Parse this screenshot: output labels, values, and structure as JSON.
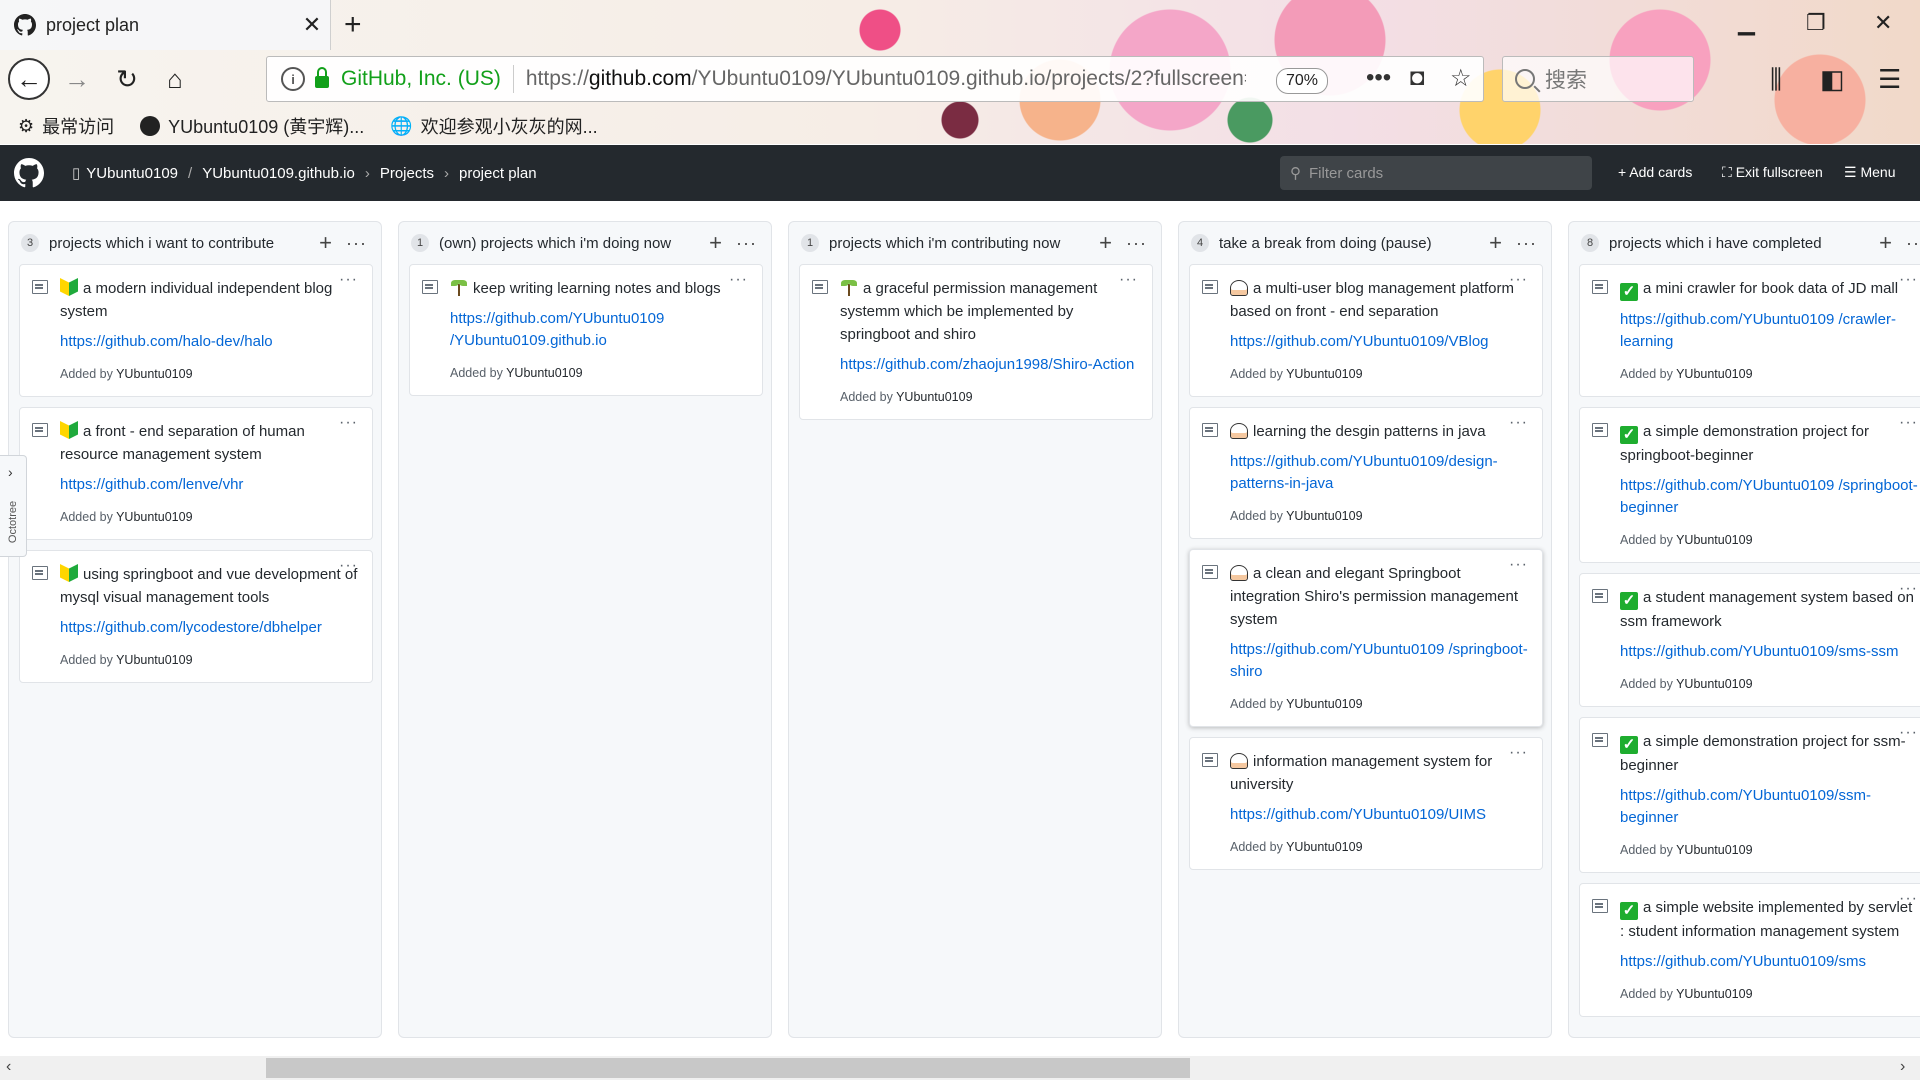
{
  "browser": {
    "tab_title": "project plan",
    "tab_close": "✕",
    "new_tab": "+",
    "url_org": "GitHub, Inc. (US)",
    "url_prefix": "https://",
    "url_domain": "github.com",
    "url_path": "/YUbuntu0109/YUbuntu0109.github.io/projects/2?fullscreen=true",
    "zoom": "70%",
    "search_placeholder": "搜索",
    "bookmarks": [
      "最常访问",
      "YUbuntu0109 (黄宇辉)...",
      "欢迎参观小灰灰的网..."
    ]
  },
  "github_header": {
    "owner": "YUbuntu0109",
    "repo": "YUbuntu0109.github.io",
    "projects": "Projects",
    "project": "project plan",
    "filter_placeholder": "Filter cards",
    "add_cards": "Add cards",
    "exit_fullscreen": "Exit fullscreen",
    "menu": "Menu"
  },
  "octotree_label": "Octotree",
  "columns": [
    {
      "count": "3",
      "title": "projects which i want to contribute",
      "cards": [
        {
          "emoji": "beginner",
          "text": "a modern individual independent blog system",
          "link": "https://github.com/halo-dev/halo",
          "added_label": "Added by",
          "added_by": "YUbuntu0109"
        },
        {
          "emoji": "beginner",
          "text": "a front - end separation of human resource management system",
          "link": "https://github.com/lenve/vhr",
          "added_label": "Added by",
          "added_by": "YUbuntu0109"
        },
        {
          "emoji": "beginner",
          "text": "using springboot and vue development of mysql visual management tools",
          "link": "https://github.com/lycodestore/dbhelper",
          "added_label": "Added by",
          "added_by": "YUbuntu0109"
        }
      ]
    },
    {
      "count": "1",
      "title": "(own)  projects which i'm doing now",
      "cards": [
        {
          "emoji": "seedling",
          "text": "keep writing learning notes and blogs",
          "link": "https://github.com/YUbuntu0109 /YUbuntu0109.github.io",
          "added_label": "Added by",
          "added_by": "YUbuntu0109"
        }
      ]
    },
    {
      "count": "1",
      "title": "projects which i'm contributing now",
      "cards": [
        {
          "emoji": "seedling",
          "text": "a graceful permission management systemm which be implemented by springboot and shiro",
          "link": "https://github.com/zhaojun1998/Shiro-Action",
          "added_label": "Added by",
          "added_by": "YUbuntu0109"
        }
      ]
    },
    {
      "count": "4",
      "title": "take a break from doing  (pause)",
      "cards": [
        {
          "emoji": "cake",
          "text": "a multi-user blog management platform based on front - end separation",
          "link": "https://github.com/YUbuntu0109/VBlog",
          "added_label": "Added by",
          "added_by": "YUbuntu0109"
        },
        {
          "emoji": "cake",
          "text": "learning the desgin patterns in java",
          "link": "https://github.com/YUbuntu0109/design-patterns-in-java",
          "added_label": "Added by",
          "added_by": "YUbuntu0109"
        },
        {
          "emoji": "cake",
          "text": "a clean and elegant Springboot integration Shiro's permission management system",
          "link": "https://github.com/YUbuntu0109 /springboot-shiro",
          "added_label": "Added by",
          "added_by": "YUbuntu0109",
          "raised": true
        },
        {
          "emoji": "cake",
          "text": "information management system for university",
          "link": "https://github.com/YUbuntu0109/UIMS",
          "added_label": "Added by",
          "added_by": "YUbuntu0109"
        }
      ]
    },
    {
      "count": "8",
      "title": "projects which i have completed",
      "cards": [
        {
          "emoji": "check",
          "text": "a mini crawler for book data of JD mall",
          "link": "https://github.com/YUbuntu0109 /crawler-learning",
          "added_label": "Added by",
          "added_by": "YUbuntu0109"
        },
        {
          "emoji": "check",
          "text": "a simple demonstration project for springboot-beginner",
          "link": "https://github.com/YUbuntu0109 /springboot-beginner",
          "added_label": "Added by",
          "added_by": "YUbuntu0109"
        },
        {
          "emoji": "check",
          "text": "a student management system based on ssm framework",
          "link": "https://github.com/YUbuntu0109/sms-ssm",
          "added_label": "Added by",
          "added_by": "YUbuntu0109"
        },
        {
          "emoji": "check",
          "text": "a simple demonstration project for ssm-beginner",
          "link": "https://github.com/YUbuntu0109/ssm-beginner",
          "added_label": "Added by",
          "added_by": "YUbuntu0109"
        },
        {
          "emoji": "check",
          "text": "a simple website implemented by servlet : student information management system",
          "link": "https://github.com/YUbuntu0109/sms",
          "added_label": "Added by",
          "added_by": "YUbuntu0109"
        }
      ]
    }
  ]
}
